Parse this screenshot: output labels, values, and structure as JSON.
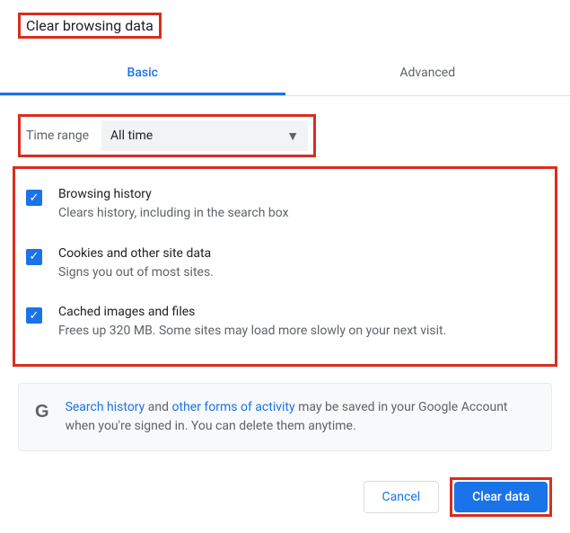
{
  "title": "Clear browsing data",
  "tabs": {
    "basic": "Basic",
    "advanced": "Advanced"
  },
  "time_range": {
    "label": "Time range",
    "value": "All time"
  },
  "options": [
    {
      "title": "Browsing history",
      "desc": "Clears history, including in the search box",
      "checked": true
    },
    {
      "title": "Cookies and other site data",
      "desc": "Signs you out of most sites.",
      "checked": true
    },
    {
      "title": "Cached images and files",
      "desc": "Frees up 320 MB. Some sites may load more slowly on your next visit.",
      "checked": true
    }
  ],
  "notice": {
    "link1": "Search history",
    "mid1": " and ",
    "link2": "other forms of activity",
    "rest": " may be saved in your Google Account when you're signed in. You can delete them anytime."
  },
  "buttons": {
    "cancel": "Cancel",
    "clear": "Clear data"
  }
}
